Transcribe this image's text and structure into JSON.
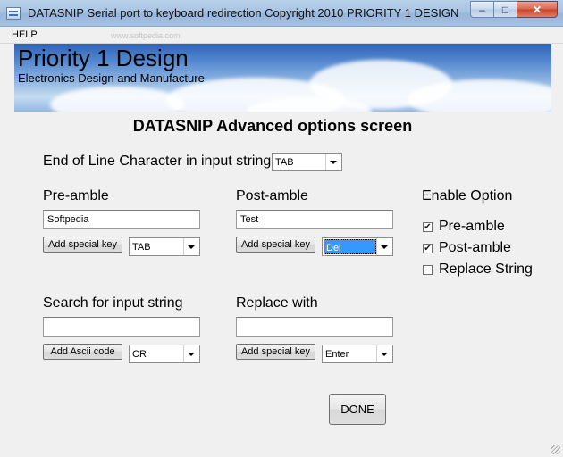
{
  "window": {
    "title": "DATASNIP Serial port to keyboard redirection     Copyright 2010 PRIORITY 1 DESIGN",
    "min_glyph": "–",
    "max_glyph": "□",
    "close_glyph": "✕"
  },
  "menu": {
    "help": "HELP",
    "watermark": "www.softpedia.com"
  },
  "banner": {
    "title": "Priority 1 Design",
    "subtitle": "Electronics Design and Manufacture"
  },
  "heading": "DATASNIP Advanced options screen",
  "eol": {
    "label": "End of Line Character in input string",
    "value": "TAB"
  },
  "preamble": {
    "label": "Pre-amble",
    "value": "Softpedia",
    "button": "Add special  key",
    "combo": "TAB"
  },
  "postamble": {
    "label": "Post-amble",
    "value": "Test",
    "button": "Add special  key",
    "combo": "Del"
  },
  "enable": {
    "label": "Enable Option",
    "options": [
      {
        "label": "Pre-amble",
        "checked": true,
        "mark": "✔"
      },
      {
        "label": "Post-amble",
        "checked": true,
        "mark": "✔"
      },
      {
        "label": "Replace String",
        "checked": false,
        "mark": ""
      }
    ]
  },
  "search": {
    "label": "Search for input string",
    "value": "",
    "button": "Add Ascii code",
    "combo": "CR"
  },
  "replace": {
    "label": "Replace with",
    "value": "",
    "button": "Add special  key",
    "combo": "Enter"
  },
  "done": "DONE"
}
